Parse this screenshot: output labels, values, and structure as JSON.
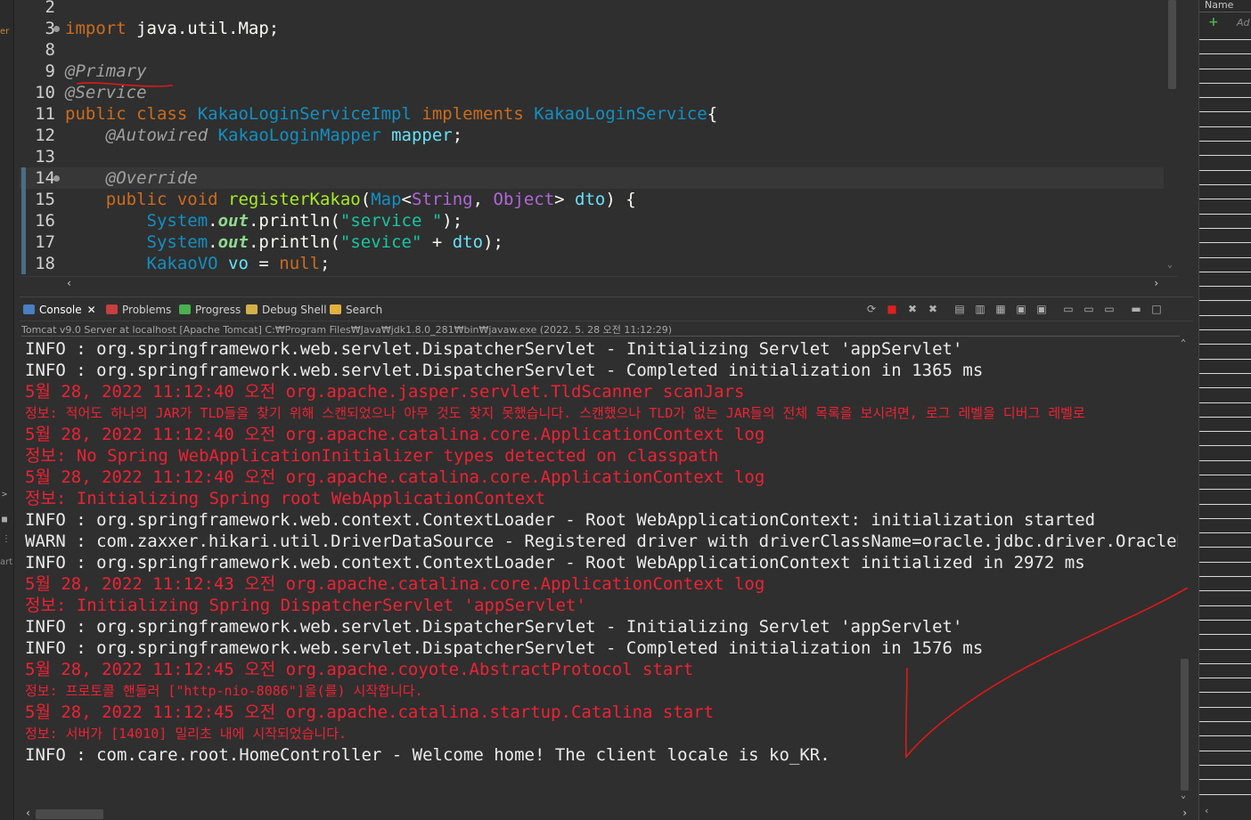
{
  "left_strip": {
    "frag_top": "er",
    "frag_bottom": "art",
    "arrow": ">",
    "dots": "⋮",
    "square": "■"
  },
  "editor": {
    "lines": [
      {
        "num": "2",
        "parts": []
      },
      {
        "num": "3",
        "parts": [
          {
            "t": "import",
            "c": "kw"
          },
          {
            "t": " java.util.Map;",
            "c": "plain"
          }
        ]
      },
      {
        "num": "8",
        "parts": []
      },
      {
        "num": "9",
        "parts": [
          {
            "t": "@Primary",
            "c": "ann"
          }
        ]
      },
      {
        "num": "10",
        "parts": [
          {
            "t": "@Service",
            "c": "ann"
          }
        ]
      },
      {
        "num": "11",
        "parts": [
          {
            "t": "public class ",
            "c": "kw"
          },
          {
            "t": "KakaoLoginServiceImpl",
            "c": "cls"
          },
          {
            "t": " implements ",
            "c": "impl"
          },
          {
            "t": "KakaoLoginService",
            "c": "cls"
          },
          {
            "t": "{",
            "c": "plain"
          }
        ]
      },
      {
        "num": "12",
        "parts": [
          {
            "t": "    @Autowired",
            "c": "ann"
          },
          {
            "t": " KakaoLoginMapper",
            "c": "cls"
          },
          {
            "t": " mapper",
            "c": "var"
          },
          {
            "t": ";",
            "c": "plain"
          }
        ]
      },
      {
        "num": "13",
        "parts": []
      },
      {
        "num": "14",
        "parts": [
          {
            "t": "    @Override",
            "c": "ann"
          }
        ]
      },
      {
        "num": "15",
        "parts": [
          {
            "t": "    public void ",
            "c": "kw"
          },
          {
            "t": "registerKakao",
            "c": "method"
          },
          {
            "t": "(",
            "c": "plain"
          },
          {
            "t": "Map",
            "c": "cls"
          },
          {
            "t": "<",
            "c": "plain"
          },
          {
            "t": "String",
            "c": "type2"
          },
          {
            "t": ", ",
            "c": "plain"
          },
          {
            "t": "Object",
            "c": "type2"
          },
          {
            "t": "> ",
            "c": "plain"
          },
          {
            "t": "dto",
            "c": "var"
          },
          {
            "t": ") {",
            "c": "plain"
          }
        ]
      },
      {
        "num": "16",
        "parts": [
          {
            "t": "        System",
            "c": "cls"
          },
          {
            "t": ".",
            "c": "plain"
          },
          {
            "t": "out",
            "c": "fld"
          },
          {
            "t": ".println(",
            "c": "plain"
          },
          {
            "t": "\"service \"",
            "c": "str"
          },
          {
            "t": ");",
            "c": "plain"
          }
        ]
      },
      {
        "num": "17",
        "parts": [
          {
            "t": "        System",
            "c": "cls"
          },
          {
            "t": ".",
            "c": "plain"
          },
          {
            "t": "out",
            "c": "fld"
          },
          {
            "t": ".println(",
            "c": "plain"
          },
          {
            "t": "\"sevice\"",
            "c": "str"
          },
          {
            "t": " + ",
            "c": "plain"
          },
          {
            "t": "dto",
            "c": "var"
          },
          {
            "t": ");",
            "c": "plain"
          }
        ]
      },
      {
        "num": "18",
        "parts": [
          {
            "t": "        KakaoVO",
            "c": "cls"
          },
          {
            "t": " vo",
            "c": "var"
          },
          {
            "t": " = ",
            "c": "plain"
          },
          {
            "t": "null",
            "c": "kw"
          },
          {
            "t": ";",
            "c": "plain"
          }
        ]
      }
    ]
  },
  "right_panel": {
    "header": "Name",
    "add_label": "Ad"
  },
  "console": {
    "tabs": [
      {
        "label": "Console",
        "icon_color": "#4a7fc1",
        "active": true,
        "close": "✕"
      },
      {
        "label": "Problems",
        "icon_color": "#c43f3f",
        "active": false
      },
      {
        "label": "Progress",
        "icon_color": "#4caf50",
        "active": false
      },
      {
        "label": "Debug Shell",
        "icon_color": "#d4b04a",
        "active": false
      },
      {
        "label": "Search",
        "icon_color": "#e0b040",
        "active": false
      }
    ],
    "toolbar_icons": [
      "sync-icon",
      "terminate-icon",
      "remove-launch-icon",
      "remove-all-icon",
      "clear-console-icon",
      "scroll-lock-icon",
      "word-wrap-icon",
      "show-on-stdout-icon",
      "show-on-stderr-icon",
      "pin-console-icon",
      "display-console-icon",
      "open-console-icon",
      "minimize-icon",
      "maximize-icon"
    ],
    "subtitle": "Tomcat v9.0 Server at localhost [Apache Tomcat] C:₩Program Files₩Java₩jdk1.8.0_281₩bin₩javaw.exe  (2022. 5. 28 오전 11:12:29)",
    "lines": [
      {
        "kind": "info",
        "text": "INFO : org.springframework.web.servlet.DispatcherServlet - Initializing Servlet 'appServlet'"
      },
      {
        "kind": "info",
        "text": "INFO : org.springframework.web.servlet.DispatcherServlet - Completed initialization in 1365 ms"
      },
      {
        "kind": "err",
        "text": "5월 28, 2022 11:12:40 오전 org.apache.jasper.servlet.TldScanner scanJars"
      },
      {
        "kind": "err",
        "text": "정보: 적어도 하나의 JAR가 TLD들을 찾기 위해 스캔되었으나 아무 것도 찾지 못했습니다. 스캔했으나 TLD가 없는 JAR들의 전체 목록을 보시려면, 로그 레벨을 디버그 레벨로",
        "small": true
      },
      {
        "kind": "err",
        "text": "5월 28, 2022 11:12:40 오전 org.apache.catalina.core.ApplicationContext log"
      },
      {
        "kind": "err",
        "text": "정보: No Spring WebApplicationInitializer types detected on classpath"
      },
      {
        "kind": "err",
        "text": "5월 28, 2022 11:12:40 오전 org.apache.catalina.core.ApplicationContext log"
      },
      {
        "kind": "err",
        "text": "정보: Initializing Spring root WebApplicationContext"
      },
      {
        "kind": "info",
        "text": "INFO : org.springframework.web.context.ContextLoader - Root WebApplicationContext: initialization started"
      },
      {
        "kind": "info",
        "text": "WARN : com.zaxxer.hikari.util.DriverDataSource - Registered driver with driverClassName=oracle.jdbc.driver.OracleDriver"
      },
      {
        "kind": "info",
        "text": "INFO : org.springframework.web.context.ContextLoader - Root WebApplicationContext initialized in 2972 ms"
      },
      {
        "kind": "err",
        "text": "5월 28, 2022 11:12:43 오전 org.apache.catalina.core.ApplicationContext log"
      },
      {
        "kind": "err",
        "text": "정보: Initializing Spring DispatcherServlet 'appServlet'"
      },
      {
        "kind": "info",
        "text": "INFO : org.springframework.web.servlet.DispatcherServlet - Initializing Servlet 'appServlet'"
      },
      {
        "kind": "info",
        "text": "INFO : org.springframework.web.servlet.DispatcherServlet - Completed initialization in 1576 ms"
      },
      {
        "kind": "err",
        "text": "5월 28, 2022 11:12:45 오전 org.apache.coyote.AbstractProtocol start"
      },
      {
        "kind": "err",
        "text": "정보: 프로토콜 핸들러 [\"http-nio-8086\"]을(를) 시작합니다.",
        "small": true
      },
      {
        "kind": "err",
        "text": "5월 28, 2022 11:12:45 오전 org.apache.catalina.startup.Catalina start"
      },
      {
        "kind": "err",
        "text": "정보: 서버가 [14010] 밀리초 내에 시작되었습니다.",
        "small": true
      },
      {
        "kind": "info",
        "text": "INFO : com.care.root.HomeController - Welcome home! The client locale is ko_KR."
      }
    ]
  },
  "colors": {
    "background": "#2f2f2f",
    "info_text": "#ebebeb",
    "error_text": "#ee2233",
    "annotation_marker": "#e01818"
  }
}
